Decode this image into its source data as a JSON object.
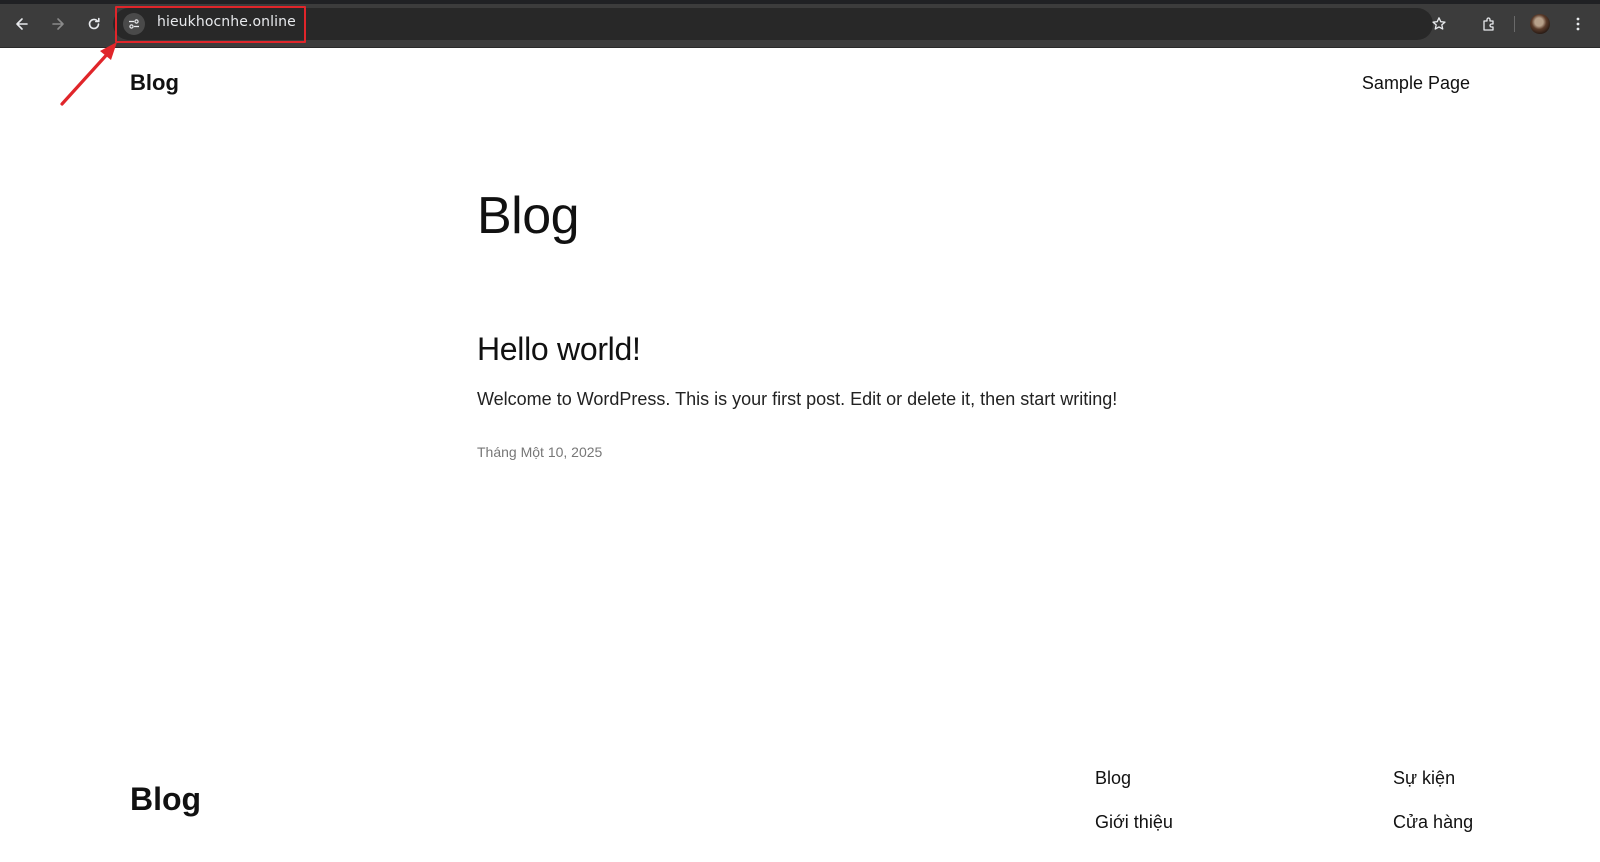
{
  "browser": {
    "url": "hieukhocnhe.online",
    "colors": {
      "chrome_bg": "#3c3c3c",
      "omnibox_bg": "#282828",
      "highlight": "#e0252a"
    },
    "icons": [
      "back-arrow-icon",
      "forward-arrow-icon",
      "reload-icon",
      "site-info-icon",
      "star-icon",
      "extensions-icon",
      "profile-avatar",
      "kebab-menu-icon"
    ]
  },
  "header": {
    "site_title": "Blog",
    "nav_link": "Sample Page"
  },
  "main": {
    "page_heading": "Blog",
    "post": {
      "title": "Hello world!",
      "excerpt": "Welcome to WordPress. This is your first post. Edit or delete it, then start writing!",
      "date": "Tháng Một 10, 2025"
    }
  },
  "footer": {
    "site_title": "Blog",
    "links_col1": [
      "Blog",
      "Giới thiệu"
    ],
    "links_col2": [
      "Sự kiện",
      "Cửa hàng"
    ]
  }
}
